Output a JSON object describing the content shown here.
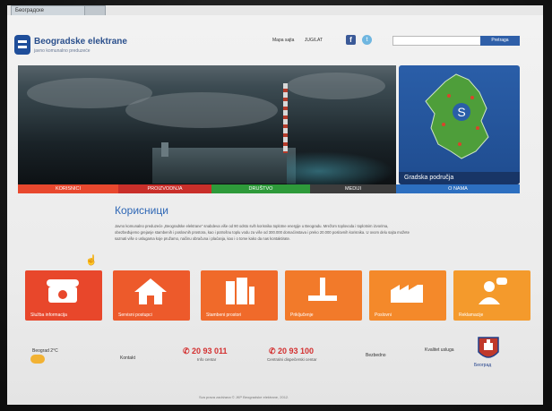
{
  "browser": {
    "tab_title": "Београдске"
  },
  "header": {
    "logo_text": "Beogradske elektrane",
    "logo_sub": "javno komunalno preduzeće",
    "top_links": [
      "Mapa sajta",
      "JUG/LAT"
    ],
    "search_placeholder": "",
    "search_button": "Pretraga"
  },
  "hero": {
    "map_caption": "Gradska područja"
  },
  "nav": {
    "items": [
      "KORISNICI",
      "PROIZVODNJA",
      "DRUŠTVO",
      "MEDIJI",
      "O NAMA"
    ]
  },
  "content": {
    "section_title": "Корисници",
    "intro": "Javno komunalno preduzeće „Beogradske elektrane“ snabdeva više od 90 odsto svih korisnika toplotne energije u Beogradu. Mrežom toplovoda i toplotnim izvorima, obezbeđujemo grejanje stambenih i poslovnih prostora, kao i potrošnu toplu vodu za više od 300.000 domaćinstava i preko 20.000 poslovnih korisnika. U ovom delu sajta možete saznati više o uslugama koje pružamo, načinu obračuna i plaćanja, kao i o tome kako da nas kontaktirate."
  },
  "tiles": [
    {
      "label": "Služba informacija",
      "color": "#e8472b",
      "icon": "telephone-icon"
    },
    {
      "label": "Servisni postupci",
      "color": "#ed5a2b",
      "icon": "home-icon"
    },
    {
      "label": "Stambeni prostori",
      "color": "#f06a2a",
      "icon": "buildings-icon"
    },
    {
      "label": "Priključenje",
      "color": "#f27a2a",
      "icon": "pipe-icon"
    },
    {
      "label": "Poslovni",
      "color": "#f4892a",
      "icon": "factory-icon"
    },
    {
      "label": "Reklamacije",
      "color": "#f49a2c",
      "icon": "person-chat-icon"
    }
  ],
  "footer": {
    "weather": "Beograd 2°C",
    "contact_link": "Kontakt",
    "phone_1": "20 93 011",
    "phone_1_sub": "Info centar",
    "phone_2": "20 93 100",
    "phone_2_sub": "Centralni dispečerski centar",
    "link_1": "Bezbedno",
    "link_2": "Kvalitet usluga",
    "beograd_label": "Београд",
    "copyright": "Sva prava zadržana © JKP Beogradske elektrane, 2012."
  }
}
